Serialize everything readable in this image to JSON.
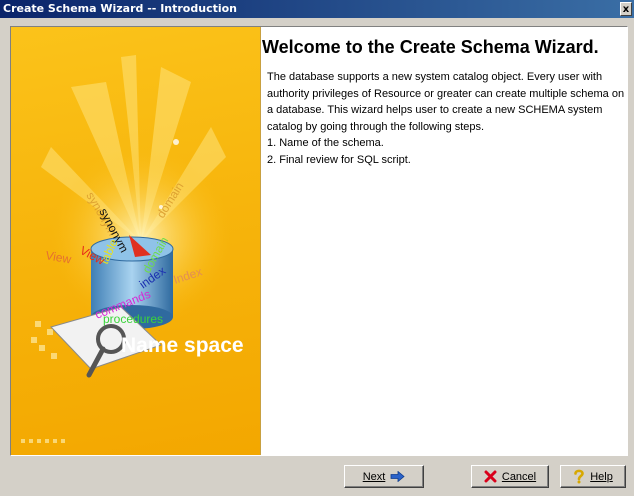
{
  "window": {
    "title": "Create Schema Wizard -- Introduction",
    "close_glyph": "x"
  },
  "art": {
    "words": [
      "synonym",
      "synonym",
      "domain",
      "domain",
      "index",
      "Index",
      "table",
      "View",
      "View",
      "commands",
      "procedures"
    ],
    "caption": "Name space"
  },
  "main": {
    "heading": "Welcome to the Create Schema Wizard.",
    "paragraph": " The database supports a new system catalog object. Every user with authority privileges of Resource or greater can create multiple schema on a database. This wizard helps user to create a new SCHEMA system catalog by going through the following steps.",
    "steps": [
      "1. Name of the schema.",
      "2. Final review for SQL script."
    ]
  },
  "buttons": {
    "next": {
      "label": "Next",
      "icon": "arrow-right-icon"
    },
    "cancel": {
      "label": "Cancel",
      "icon": "red-x-icon"
    },
    "help": {
      "label": "Help",
      "icon": "question-mark-icon"
    }
  },
  "colors": {
    "title_start": "#0a246a",
    "title_end": "#3a6ea5",
    "art_bg": "#f7b50c",
    "cancel_icon": "#d9001b",
    "help_icon": "#f0c800",
    "next_icon": "#2a62c9"
  }
}
